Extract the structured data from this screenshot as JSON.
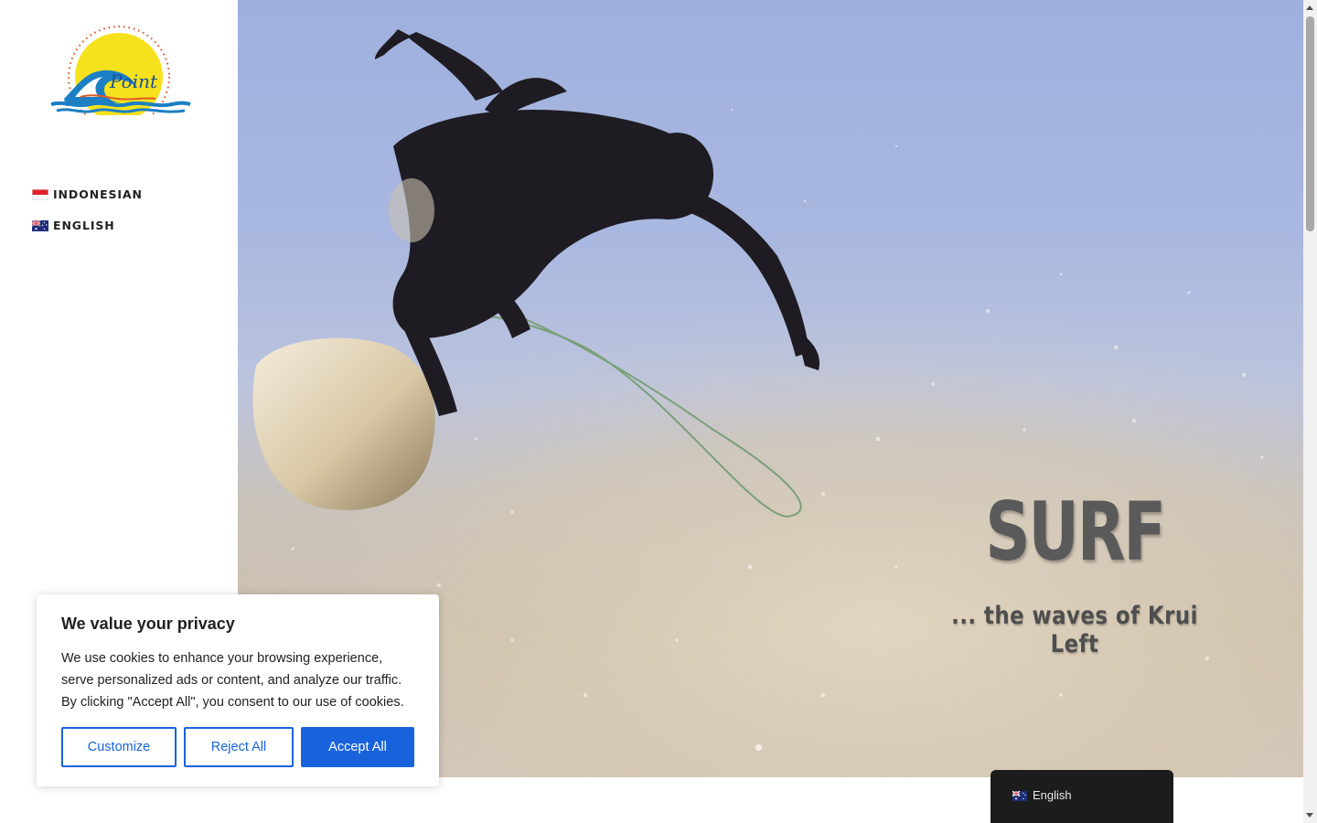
{
  "sidebar": {
    "logo_text": "Point",
    "languages": [
      {
        "label": "INDONESIAN",
        "flag": "indonesia-flag-icon"
      },
      {
        "label": "ENGLISH",
        "flag": "australia-flag-icon"
      }
    ]
  },
  "hero": {
    "title": "SURF",
    "subtitle": "... the waves of Krui Left",
    "slide_count": 1
  },
  "cookie_banner": {
    "title": "We value your privacy",
    "text": "We use cookies to enhance your browsing experience, serve personalized ads or content, and analyze our traffic. By clicking \"Accept All\", you consent to our use of cookies.",
    "customize_label": "Customize",
    "reject_label": "Reject All",
    "accept_label": "Accept All",
    "accent_color": "#1863dc"
  },
  "language_switcher": {
    "current": "English",
    "flag": "australia-flag-icon"
  }
}
